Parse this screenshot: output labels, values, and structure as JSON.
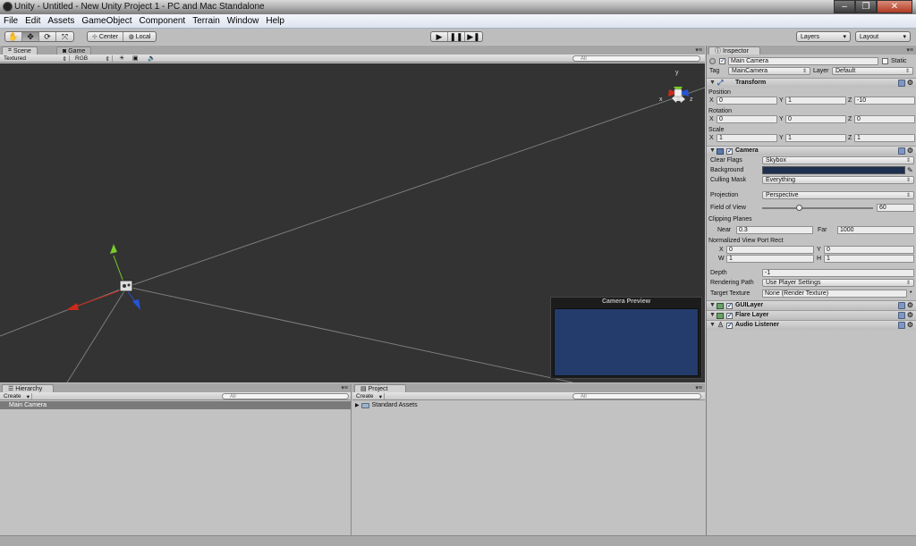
{
  "window": {
    "title": "Unity - Untitled - New Unity Project 1 - PC and Mac Standalone"
  },
  "menu": [
    "File",
    "Edit",
    "Assets",
    "GameObject",
    "Component",
    "Terrain",
    "Window",
    "Help"
  ],
  "toolbar": {
    "center_label": "Center",
    "local_label": "Local",
    "layers_label": "Layers",
    "layout_label": "Layout"
  },
  "scene": {
    "tab_scene": "Scene",
    "tab_game": "Game",
    "draw_mode": "Textured",
    "render_mode": "RGB",
    "search_placeholder": "All",
    "camera_preview_title": "Camera Preview",
    "gizmo_x": "x",
    "gizmo_y": "y",
    "gizmo_z": "z"
  },
  "hierarchy": {
    "tab": "Hierarchy",
    "create": "Create",
    "search_placeholder": "All",
    "items": [
      "Main Camera"
    ]
  },
  "project": {
    "tab": "Project",
    "create": "Create",
    "search_placeholder": "All",
    "items": [
      "Standard Assets"
    ]
  },
  "inspector": {
    "tab": "Inspector",
    "object_name": "Main Camera",
    "static_label": "Static",
    "tag_label": "Tag",
    "tag_value": "MainCamera",
    "layer_label": "Layer",
    "layer_value": "Default",
    "transform": {
      "title": "Transform",
      "position_label": "Position",
      "rotation_label": "Rotation",
      "scale_label": "Scale",
      "x": "X",
      "y": "Y",
      "z": "Z",
      "position": [
        "0",
        "1",
        "-10"
      ],
      "rotation": [
        "0",
        "0",
        "0"
      ],
      "scale": [
        "1",
        "1",
        "1"
      ]
    },
    "camera": {
      "title": "Camera",
      "clear_flags_label": "Clear Flags",
      "clear_flags_value": "Skybox",
      "background_label": "Background",
      "background_color": "#1e2f4f",
      "culling_mask_label": "Culling Mask",
      "culling_mask_value": "Everything",
      "projection_label": "Projection",
      "projection_value": "Perspective",
      "fov_label": "Field of View",
      "fov_value": "60",
      "fov_fraction": 0.33,
      "clipping_label": "Clipping Planes",
      "near_label": "Near",
      "near_value": "0.3",
      "far_label": "Far",
      "far_value": "1000",
      "viewport_label": "Normalized View Port Rect",
      "vp_x_label": "X",
      "vp_x": "0",
      "vp_y_label": "Y",
      "vp_y": "0",
      "vp_w_label": "W",
      "vp_w": "1",
      "vp_h_label": "H",
      "vp_h": "1",
      "depth_label": "Depth",
      "depth_value": "-1",
      "rendering_path_label": "Rendering Path",
      "rendering_path_value": "Use Player Settings",
      "target_texture_label": "Target Texture",
      "target_texture_value": "None (Render Texture)"
    },
    "components": [
      "GUILayer",
      "Flare Layer",
      "Audio Listener"
    ]
  }
}
